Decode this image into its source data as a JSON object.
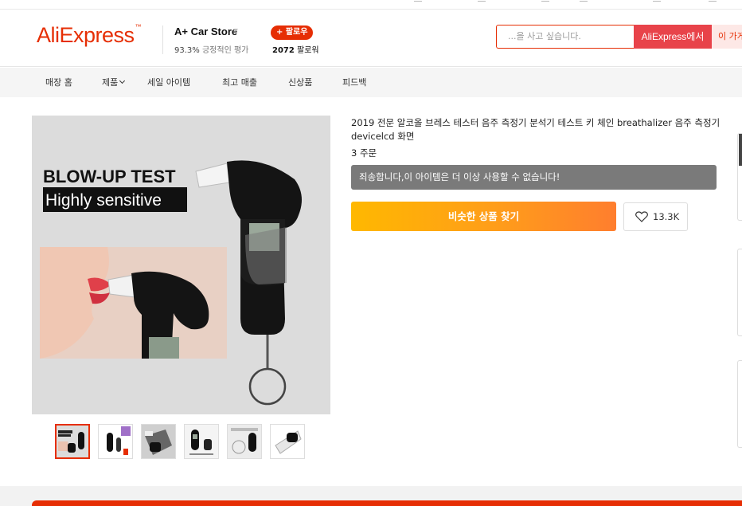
{
  "header": {
    "logo": "AliExpress",
    "logo_mark": "™",
    "store": {
      "name": "A+ Car Store",
      "rating_value": "93.3%",
      "rating_label": "긍정적인 평가",
      "follow_label": "+ 팔로우",
      "followers_count": "2072",
      "followers_label": "팔로워"
    },
    "search": {
      "placeholder": "...을 사고 싶습니다.",
      "button_aliexpress": "AliExpress에서",
      "button_store": "이 가게"
    }
  },
  "nav": {
    "items": [
      {
        "label": "매장 홈"
      },
      {
        "label": "제품"
      },
      {
        "label": "세일 아이템"
      },
      {
        "label": "최고 매출"
      },
      {
        "label": "신상품"
      },
      {
        "label": "피드백"
      }
    ]
  },
  "product": {
    "title": "2019 전문 알코올 브레스 테스터 음주 측정기 분석기 테스트 키 체인 breathalizer 음주 측정기 devicelcd 화면",
    "orders": "3 주문",
    "unavailable_notice": "죄송합니다,이 아이템은 더 이상 사용할 수 없습니다!",
    "find_similar_label": "비슷한 상품 찾기",
    "wishlist_count": "13.3K",
    "image": {
      "headline": "BLOW-UP TEST",
      "subline": "Highly sensitive"
    },
    "thumbnail_count": 6
  },
  "colors": {
    "brand": "#e62e04",
    "notice_bg": "#7a7a7a",
    "button_gradient_start": "#ffb800",
    "button_gradient_end": "#ff7e2e"
  }
}
